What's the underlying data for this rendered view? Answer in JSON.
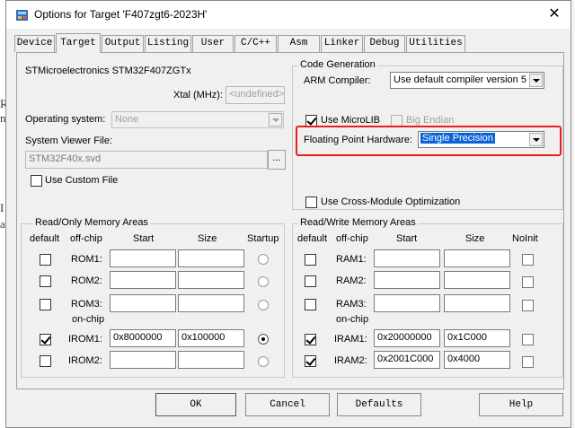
{
  "background": {
    "glyphs": [
      "R",
      "n",
      "I",
      "a"
    ]
  },
  "window": {
    "title": "Options for Target 'F407zgt6-2023H'",
    "close_glyph": "✕"
  },
  "tabs": [
    "Device",
    "Target",
    "Output",
    "Listing",
    "User",
    "C/C++",
    "Asm",
    "Linker",
    "Debug",
    "Utilities"
  ],
  "device": {
    "name": "STMicroelectronics STM32F407ZGTx",
    "xtal_label": "Xtal (MHz):",
    "xtal_value": "<undefined>",
    "os_label": "Operating system:",
    "os_value": "None",
    "svf_label": "System Viewer File:",
    "svf_value": "STM32F40x.svd",
    "browse_label": "...",
    "custom_file_label": "Use Custom File"
  },
  "codegen": {
    "title": "Code Generation",
    "compiler_label": "ARM Compiler:",
    "compiler_value": "Use default compiler version 5",
    "microlib_label": "Use MicroLIB",
    "microlib_checked": true,
    "big_endian_label": "Big Endian",
    "fph_label": "Floating Point Hardware:",
    "fph_value": "Single Precision",
    "cross_module_label": "Use Cross-Module Optimization"
  },
  "ro_memory": {
    "title": "Read/Only Memory Areas",
    "headers": {
      "default": "default",
      "offchip": "off-chip",
      "start": "Start",
      "size": "Size",
      "startup": "Startup"
    },
    "onchip_label": "on-chip",
    "rows": [
      {
        "name": "ROM1:",
        "start": "",
        "size": "",
        "default": false,
        "startup": false
      },
      {
        "name": "ROM2:",
        "start": "",
        "size": "",
        "default": false,
        "startup": false
      },
      {
        "name": "ROM3:",
        "start": "",
        "size": "",
        "default": false,
        "startup": false
      },
      {
        "name": "IROM1:",
        "start": "0x8000000",
        "size": "0x100000",
        "default": true,
        "startup": true
      },
      {
        "name": "IROM2:",
        "start": "",
        "size": "",
        "default": false,
        "startup": false
      }
    ]
  },
  "rw_memory": {
    "title": "Read/Write Memory Areas",
    "headers": {
      "default": "default",
      "offchip": "off-chip",
      "start": "Start",
      "size": "Size",
      "noinit": "NoInit"
    },
    "onchip_label": "on-chip",
    "rows": [
      {
        "name": "RAM1:",
        "start": "",
        "size": "",
        "default": false,
        "noinit": false
      },
      {
        "name": "RAM2:",
        "start": "",
        "size": "",
        "default": false,
        "noinit": false
      },
      {
        "name": "RAM3:",
        "start": "",
        "size": "",
        "default": false,
        "noinit": false
      },
      {
        "name": "IRAM1:",
        "start": "0x20000000",
        "size": "0x1C000",
        "default": true,
        "noinit": false
      },
      {
        "name": "IRAM2:",
        "start": "0x2001C000",
        "size": "0x4000",
        "default": true,
        "noinit": false
      }
    ]
  },
  "buttons": {
    "ok": "OK",
    "cancel": "Cancel",
    "defaults": "Defaults",
    "help": "Help"
  }
}
